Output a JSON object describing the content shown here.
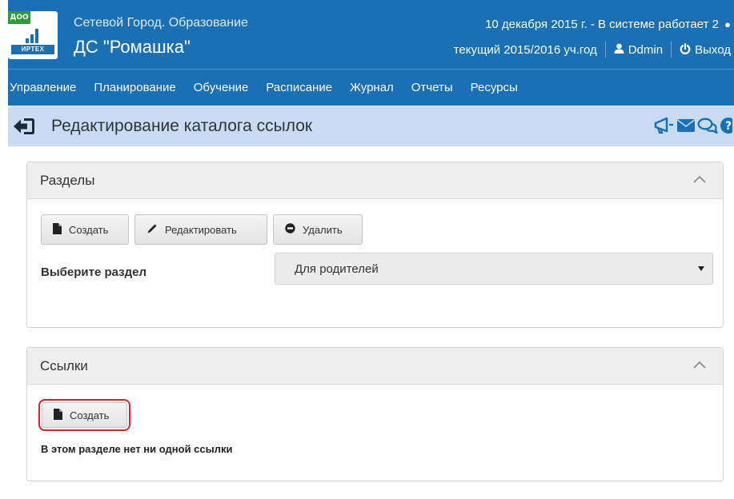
{
  "header": {
    "badge": "ДОО",
    "brand": "ИРТЕХ",
    "app_title": "Сетевой Город. Образование",
    "school_name": "ДС \"Ромашка\"",
    "date_line": "10 декабря 2015 г. - В системе работает 2",
    "school_year": "текущий 2015/2016 уч.год",
    "user_name": "Ddmin",
    "logout_label": "Выход"
  },
  "nav": {
    "items": [
      {
        "label": "Управление"
      },
      {
        "label": "Планирование"
      },
      {
        "label": "Обучение"
      },
      {
        "label": "Расписание"
      },
      {
        "label": "Журнал"
      },
      {
        "label": "Отчеты"
      },
      {
        "label": "Ресурсы"
      }
    ]
  },
  "page": {
    "title": "Редактирование каталога ссылок"
  },
  "sections_panel": {
    "title": "Разделы",
    "create_label": "Создать",
    "edit_label": "Редактировать",
    "delete_label": "Удалить",
    "select_label": "Выберите раздел",
    "select_value": "Для родителей"
  },
  "links_panel": {
    "title": "Ссылки",
    "create_label": "Создать",
    "empty_message": "В этом разделе нет ни одной ссылки"
  },
  "colors": {
    "header_blue": "#1a6fb5",
    "titlebar_blue": "#c7dcf2",
    "highlight_red": "#e0202a"
  }
}
